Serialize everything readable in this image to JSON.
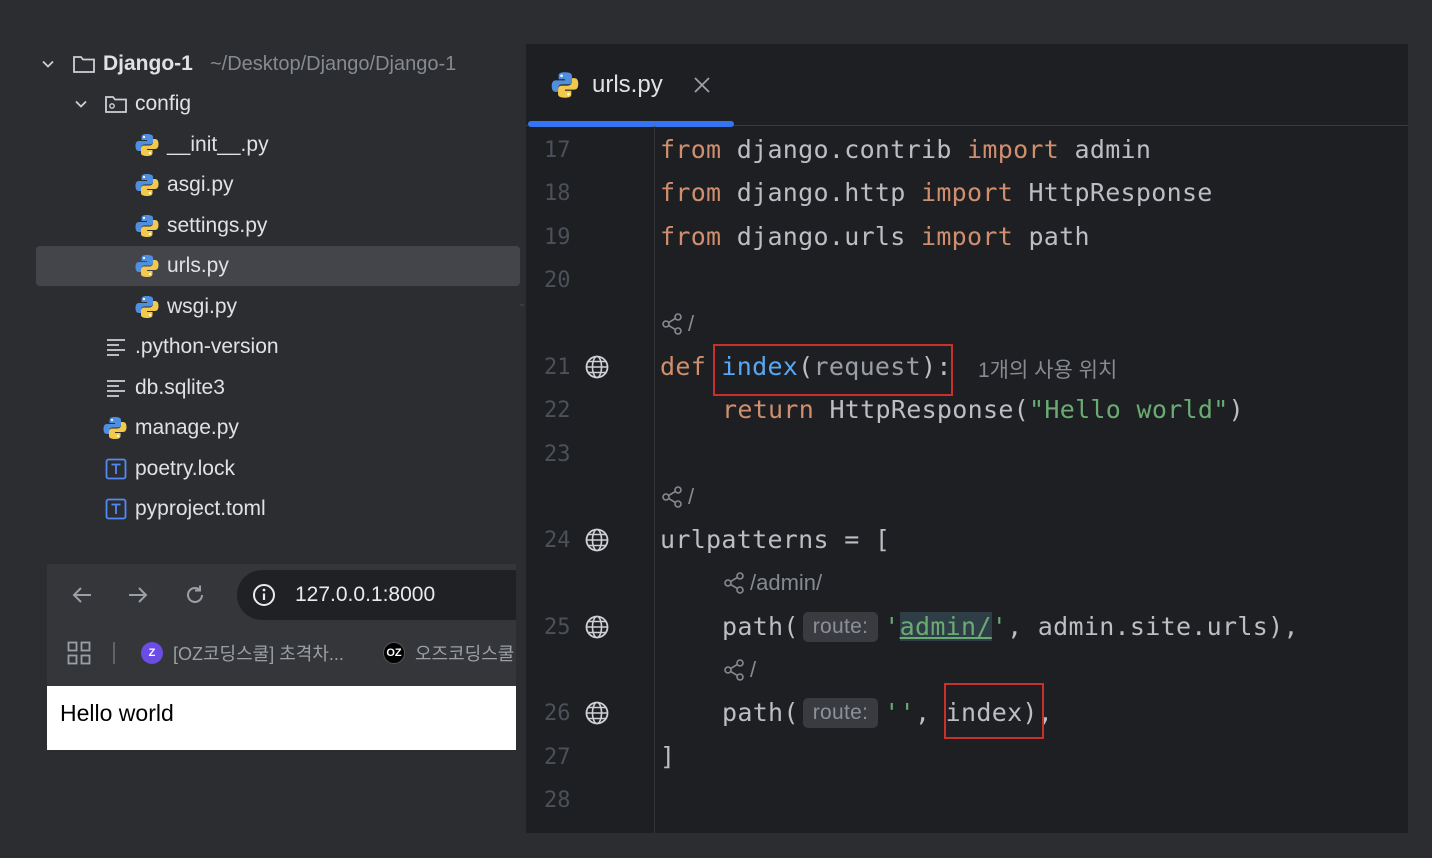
{
  "project_tree": {
    "root": {
      "name": "Django-1",
      "path": "~/Desktop/Django/Django-1"
    },
    "config_folder": "config",
    "config_files": [
      "__init__.py",
      "asgi.py",
      "settings.py",
      "urls.py",
      "wsgi.py"
    ],
    "root_files": [
      ".python-version",
      "db.sqlite3",
      "manage.py",
      "poetry.lock",
      "pyproject.toml"
    ],
    "selected": "urls.py"
  },
  "browser": {
    "url": "127.0.0.1:8000",
    "bookmarks": [
      {
        "label": "[OZ코딩스쿨] 초격차...",
        "icon": "oz-purple-icon",
        "badge": "Z"
      },
      {
        "label": "오즈코딩스쿨",
        "icon": "oz-black-icon",
        "badge": "OZ"
      }
    ],
    "page_text": "Hello world"
  },
  "editor": {
    "tab": {
      "name": "urls.py"
    },
    "line_numbers": [
      "17",
      "18",
      "19",
      "20",
      "21",
      "22",
      "23",
      "24",
      "25",
      "26",
      "27",
      "28"
    ],
    "code": {
      "l17": {
        "kw1": "from",
        "mod": " django.contrib ",
        "kw2": "import",
        "name": " admin"
      },
      "l18": {
        "kw1": "from",
        "mod": " django.http ",
        "kw2": "import",
        "name": " HttpResponse"
      },
      "l19": {
        "kw1": "from",
        "mod": " django.urls ",
        "kw2": "import",
        "name": " path"
      },
      "l21": {
        "kw": "def ",
        "fn": "index",
        "open": "(",
        "param": "request",
        "close": "):"
      },
      "l22": {
        "kw": "return",
        "call": " HttpResponse(",
        "str": "\"Hello world\"",
        "close": ")"
      },
      "l24": {
        "text": "urlpatterns = ["
      },
      "l25": {
        "call": "path(",
        "inlay": "route:",
        "q1": "'",
        "link": "admin/",
        "q2": "'",
        "rest": ", admin.site.urls),"
      },
      "l26": {
        "call": "path(",
        "inlay": "route:",
        "str": "''",
        "comma": ", ",
        "target": "index)",
        "tail": ","
      },
      "l27": {
        "text": "]"
      }
    },
    "usage_hint": "1개의 사용 위치",
    "endpoints": {
      "index_def": "/",
      "urlpatterns": "/",
      "admin": "/admin/",
      "root": "/"
    }
  },
  "colors": {
    "keyword": "#cf8e6d",
    "function": "#56a8f5",
    "string": "#6aab73",
    "highlight_box": "#c9302c",
    "tab_accent": "#3574f0"
  }
}
